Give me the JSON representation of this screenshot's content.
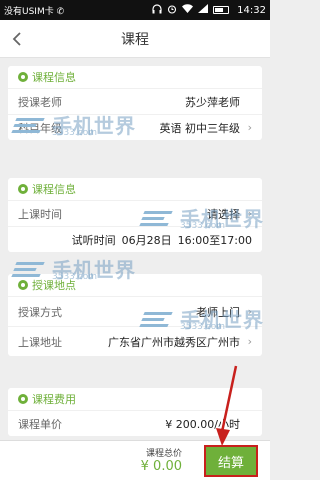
{
  "status_bar": {
    "carrier": "没有USIM卡 ✆",
    "time": "14:32"
  },
  "header": {
    "title": "课程",
    "back_icon": "chevron-left-icon"
  },
  "course_info": {
    "heading": "课程信息",
    "teacher_label": "授课老师",
    "teacher_value": "苏少萍老师",
    "subject_label": "科目年级",
    "subject_value": "英语 初中三年级"
  },
  "lesson_info": {
    "heading": "课程信息",
    "time_label": "上课时间",
    "time_value": "请选择",
    "trial_label": "试听时间",
    "trial_date": "06月28日",
    "trial_time": "16:00至17:00"
  },
  "location": {
    "heading": "授课地点",
    "method_label": "授课方式",
    "method_value": "老师上门",
    "address_label": "上课地址",
    "address_value": "广东省广州市越秀区广州市"
  },
  "fees": {
    "heading": "课程费用",
    "unit_label": "课程单价",
    "unit_value": "¥ 200.00/小时"
  },
  "footer": {
    "total_label": "课程总价",
    "total_value": "¥ 0.00",
    "checkout_label": "结算"
  },
  "watermark": {
    "text": "手机世界",
    "sub": "3533.com"
  },
  "colors": {
    "accent": "#6fb03a",
    "annotation": "#c8201d"
  }
}
